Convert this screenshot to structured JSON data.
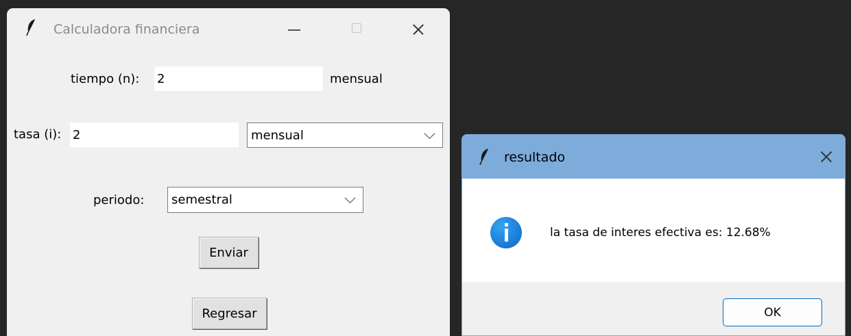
{
  "main_window": {
    "title": "Calculadora financiera",
    "tiempo_label": "tiempo (n):",
    "tiempo_value": "2",
    "tiempo_unit": "mensual",
    "tasa_label": "tasa (i):",
    "tasa_value": "2",
    "tasa_period_selected": "mensual",
    "periodo_label": "periodo:",
    "periodo_selected": "semestral",
    "enviar_label": "Enviar",
    "regresar_label": "Regresar"
  },
  "dialog": {
    "title": "resultado",
    "message": "la tasa de interes efectiva es: 12.68%",
    "ok_label": "OK"
  },
  "colors": {
    "desktop": "#262626",
    "window_bg": "#f0f0f0",
    "dialog_titlebar": "#7eacda",
    "ok_border": "#0067c0",
    "info_icon": "#0c66c9"
  },
  "icons": [
    "feather-icon",
    "minimize-icon",
    "maximize-icon",
    "close-icon",
    "info-icon",
    "chevron-down-icon"
  ]
}
